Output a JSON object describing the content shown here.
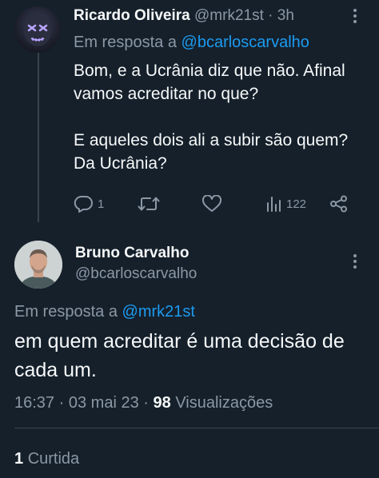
{
  "colors": {
    "background": "#15202b",
    "primary_text": "#f7f9f9",
    "secondary_text": "#8b98a5",
    "link": "#1d9bf0",
    "divider": "#38444d"
  },
  "reply_tweet": {
    "author_name": "Ricardo Oliveira",
    "author_handle": "@mrk21st",
    "separator": "·",
    "time": "3h",
    "replying_prefix": "Em resposta a",
    "replying_to": "@bcarloscarvalho",
    "text_paragraphs": [
      "Bom, e a Ucrânia diz que não. Afinal vamos acreditar no que?",
      "E aqueles dois ali a subir são quem? Da Ucrânia?"
    ],
    "actions": {
      "reply_count": "1",
      "views_count": "122"
    },
    "icons": [
      "more-icon",
      "reply-icon",
      "retweet-icon",
      "like-icon",
      "views-icon",
      "share-icon"
    ]
  },
  "main_tweet": {
    "author_name": "Bruno Carvalho",
    "author_handle": "@bcarloscarvalho",
    "replying_prefix": "Em resposta a",
    "replying_to": "@mrk21st",
    "text": "em quem acreditar é uma decisão de cada um.",
    "time": "16:37",
    "separator": "·",
    "date": "03 mai 23",
    "views_count": "98",
    "views_label": "Visualizações",
    "likes_count": "1",
    "likes_label": "Curtida"
  }
}
